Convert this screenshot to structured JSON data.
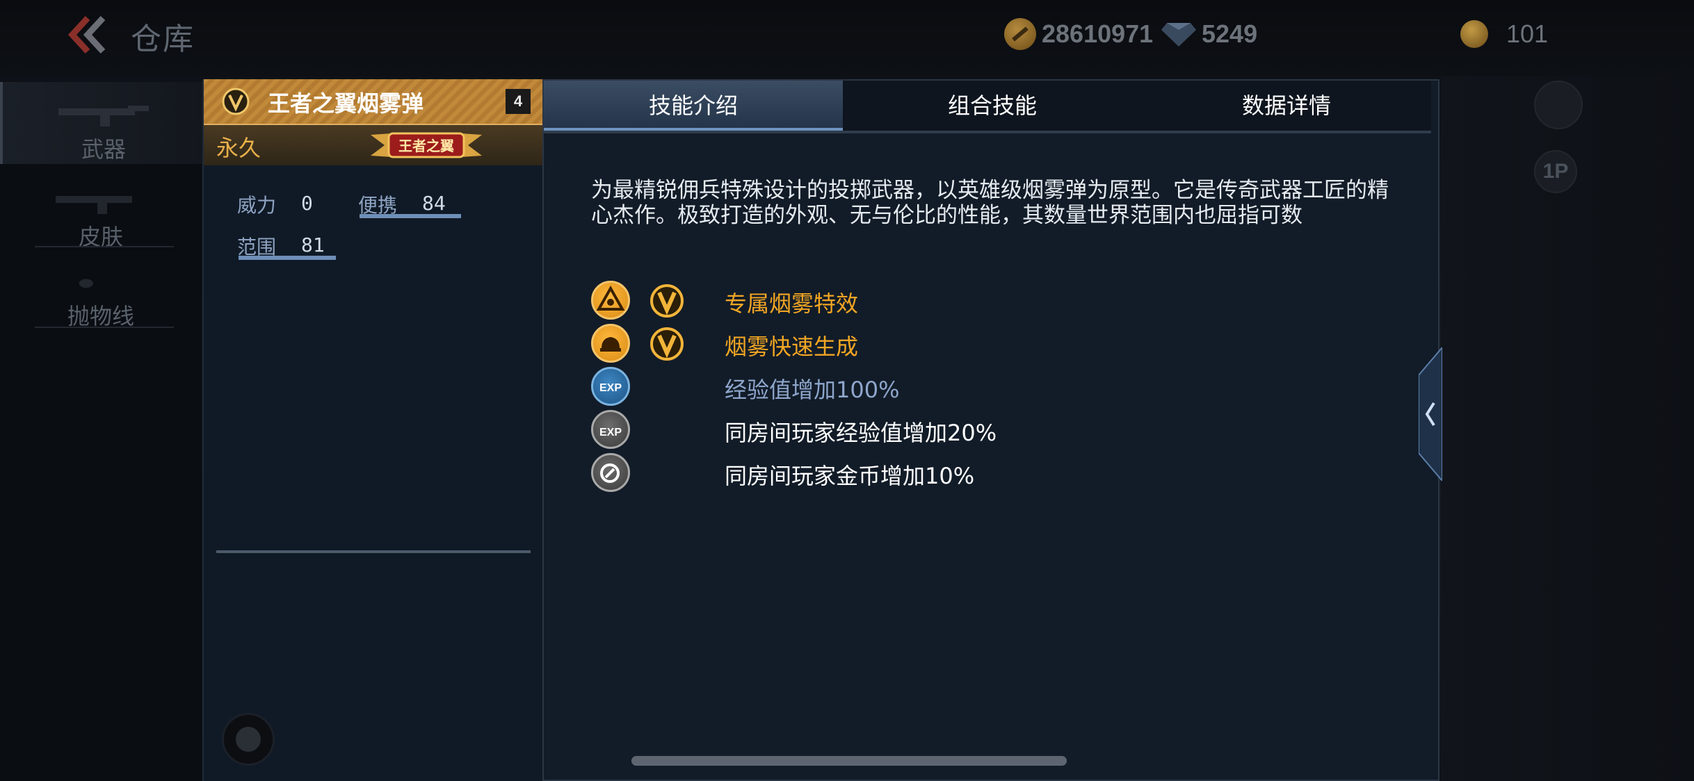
{
  "topbar": {
    "title": "仓库",
    "gold": "28610971",
    "diamonds": "5249",
    "medals": "101"
  },
  "sidebar": {
    "items": [
      {
        "label": "武器",
        "active": true
      },
      {
        "label": "皮肤",
        "active": false
      },
      {
        "label": "抛物线",
        "active": false
      }
    ]
  },
  "item": {
    "name": "王者之翼烟雾弹",
    "count": "4",
    "duration": "永久",
    "badge_text": "王者之翼",
    "stats": [
      {
        "label": "威力",
        "value": "0"
      },
      {
        "label": "便携",
        "value": "84"
      },
      {
        "label": "范围",
        "value": "81"
      }
    ]
  },
  "tabs": [
    {
      "label": "技能介绍",
      "active": true
    },
    {
      "label": "组合技能",
      "active": false
    },
    {
      "label": "数据详情",
      "active": false
    }
  ],
  "description": "为最精锐佣兵特殊设计的投掷武器，以英雄级烟雾弹为原型。它是传奇武器工匠的精心杰作。极致打造的外观、无与伦比的性能，其数量世界范围内也屈指可数",
  "skills": [
    {
      "text": "专属烟雾特效",
      "icon": "smoke-effect-icon",
      "color": "#f2a623",
      "has_v": true
    },
    {
      "text": "烟雾快速生成",
      "icon": "smoke-generate-icon",
      "color": "#f2a623",
      "has_v": true
    },
    {
      "text": "经验值增加100%",
      "icon": "exp-icon",
      "color": "#8ea6cc",
      "has_v": false
    },
    {
      "text": "同房间玩家经验值增加20%",
      "icon": "room-exp-icon",
      "color": "#ffffff",
      "has_v": false
    },
    {
      "text": "同房间玩家金币增加10%",
      "icon": "room-coin-icon",
      "color": "#ffffff",
      "has_v": false
    }
  ],
  "colors": {
    "gold_text": "#f2a623",
    "blue_text": "#8ea6cc",
    "stat_bar": "#6e8fb8"
  },
  "background_buttons": {
    "player_label": "1P"
  }
}
